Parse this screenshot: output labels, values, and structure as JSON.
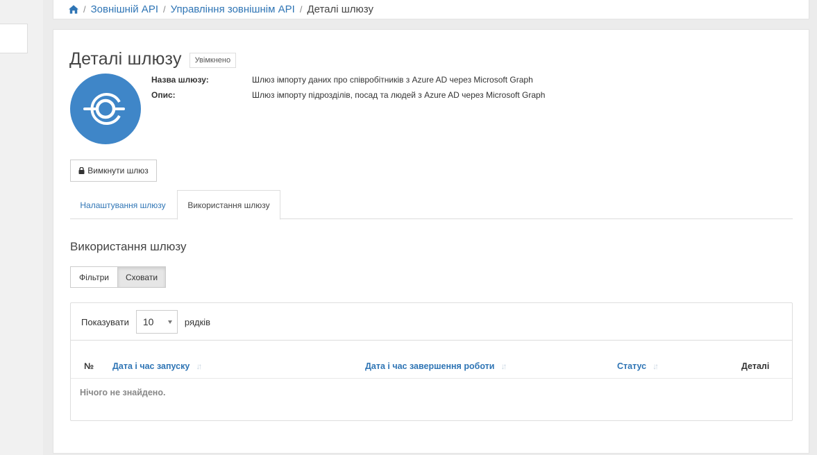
{
  "breadcrumb": {
    "home_icon": "home-icon",
    "items": [
      "Зовнішній API",
      "Управління зовнішнім API"
    ],
    "current": "Деталі шлюзу",
    "separator": "/"
  },
  "gateway": {
    "title": "Деталі шлюзу",
    "status": "Увімкнено",
    "logo_icon": "gateway-plug-icon",
    "name_label": "Назва шлюзу:",
    "name_value": "Шлюз імпорту даних про співробітників з Azure AD через Microsoft Graph",
    "desc_label": "Опис:",
    "desc_value": "Шлюз імпорту підрозділів, посад та людей з Azure AD через Microsoft Graph",
    "disable_button": "Вимкнути шлюз",
    "lock_icon": "lock-icon"
  },
  "tabs": [
    {
      "label": "Налаштування шлюзу",
      "active": false
    },
    {
      "label": "Використання шлюзу",
      "active": true
    }
  ],
  "usage": {
    "section_title": "Використання шлюзу",
    "filters_button": "Фільтри",
    "hide_button": "Сховати",
    "show_label": "Показувати",
    "page_size": "10",
    "rows_label": "рядків",
    "columns": {
      "num": "№",
      "start": "Дата і час запуску",
      "end": "Дата і час завершення роботи",
      "status": "Статус",
      "details": "Деталі"
    },
    "empty_text": "Нічого не знайдено."
  },
  "colors": {
    "link": "#2f75b5",
    "logo_bg": "#3f86c8"
  }
}
